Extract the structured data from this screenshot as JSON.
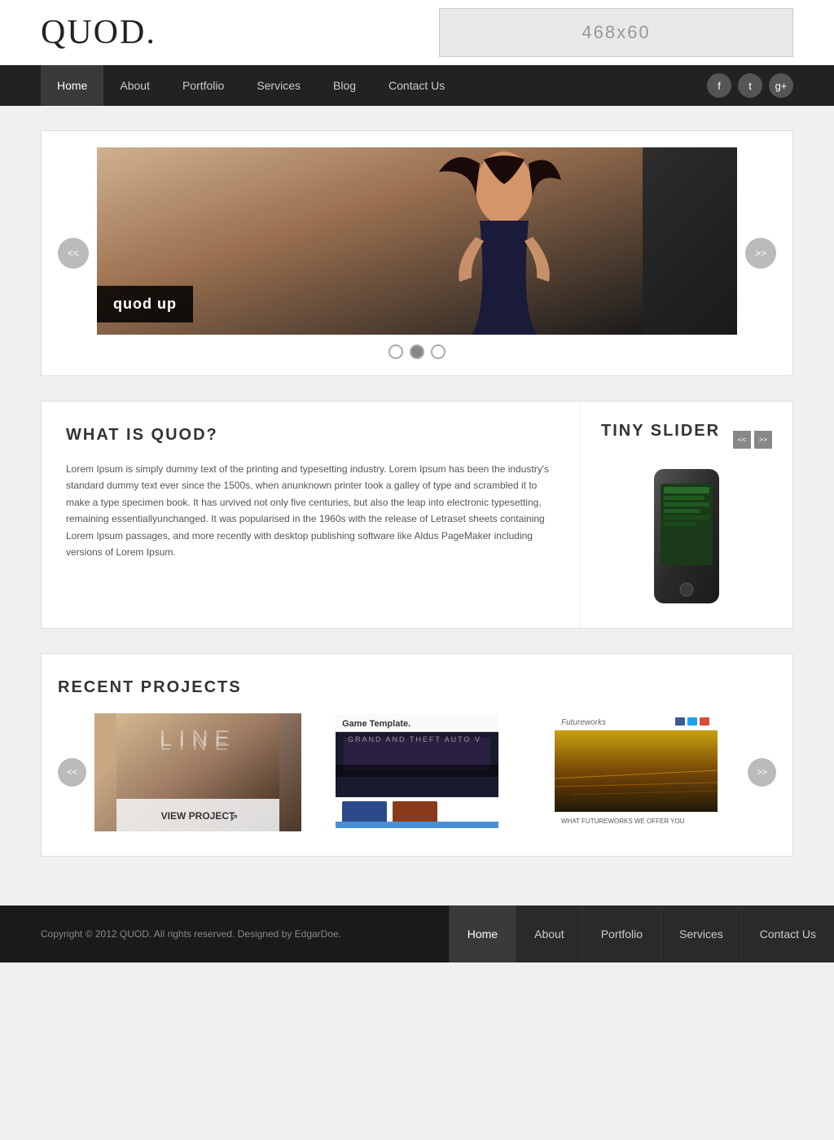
{
  "header": {
    "logo": "QUOD.",
    "ad_text": "468x60"
  },
  "nav": {
    "items": [
      {
        "label": "Home",
        "active": true
      },
      {
        "label": "About",
        "active": false
      },
      {
        "label": "Portfolio",
        "active": false
      },
      {
        "label": "Services",
        "active": false
      },
      {
        "label": "Blog",
        "active": false
      },
      {
        "label": "Contact Us",
        "active": false
      }
    ],
    "social": [
      {
        "name": "facebook",
        "icon": "f"
      },
      {
        "name": "twitter",
        "icon": "t"
      },
      {
        "name": "google-plus",
        "icon": "g+"
      }
    ]
  },
  "slider": {
    "prev_label": "<<",
    "next_label": ">>",
    "caption": "quod up",
    "dots": [
      1,
      2,
      3
    ]
  },
  "what_is_quod": {
    "title": "WHAT IS QUOD?",
    "text": "Lorem Ipsum is simply dummy text of the printing and typesetting industry. Lorem Ipsum has been the industry's standard dummy text ever since the 1500s, when anunknown printer took a galley of type and scrambled it to make a type specimen book. It has urvived not only five centuries, but also the leap into electronic typesetting, remaining essentiallyunchanged. It was popularised in the 1960s with the release of Letraset sheets containing Lorem Ipsum passages, and more recently with desktop publishing software like Aldus PageMaker including versions of Lorem Ipsum."
  },
  "tiny_slider": {
    "title": "TINY SLIDER",
    "prev_label": "<<",
    "next_label": ">>"
  },
  "recent_projects": {
    "title": "RECENT PROJECTS",
    "prev_label": "<<",
    "next_label": ">>",
    "projects": [
      {
        "name": "LINE",
        "view_label": "VIEW PROJECT"
      },
      {
        "name": "Game Template",
        "subtitle": "Game Template."
      },
      {
        "name": "Futureworks"
      }
    ]
  },
  "footer": {
    "copyright": "Copyright © 2012 QUOD. All rights reserved. Designed by EdgarDoe.",
    "nav_items": [
      {
        "label": "Home"
      },
      {
        "label": "About"
      },
      {
        "label": "Portfolio"
      },
      {
        "label": "Services"
      },
      {
        "label": "Contact Us"
      }
    ]
  }
}
